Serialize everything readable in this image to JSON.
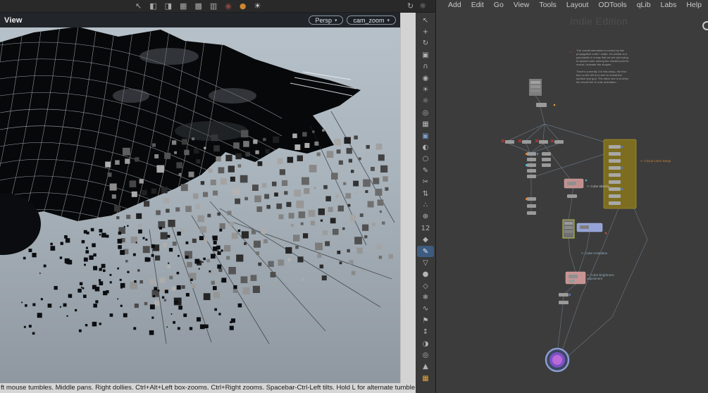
{
  "top_toolbar": {
    "icons": [
      {
        "name": "select-mode-icon",
        "glyph": "↖"
      },
      {
        "name": "viewport-split-icon",
        "glyph": "◧"
      },
      {
        "name": "pane-layout-icon",
        "glyph": "◨"
      },
      {
        "name": "grid-snap-icon",
        "glyph": "▦"
      },
      {
        "name": "multi-pane-icon",
        "glyph": "▩"
      },
      {
        "name": "tab-stack-icon",
        "glyph": "▥"
      },
      {
        "name": "record-icon",
        "glyph": "◉",
        "color": "#8a4545"
      },
      {
        "name": "status-dot-icon",
        "glyph": "●",
        "color": "#d0862f"
      },
      {
        "name": "render-settings-icon",
        "glyph": "☀",
        "color": "#dcdcdc"
      }
    ],
    "right_icons": [
      {
        "name": "sync-icon",
        "glyph": "↻"
      },
      {
        "name": "gear-icon",
        "glyph": "☼"
      }
    ]
  },
  "viewport": {
    "title": "View",
    "persp_label": "Persp",
    "cam_label": "cam_zoom",
    "dropdown_arrow": "▾",
    "help_text": "ft mouse tumbles. Middle pans. Right dollies. Ctrl+Alt+Left box-zooms. Ctrl+Right zooms. Spacebar-Ctrl-Left tilts. Hold L for alternate tumble, dolly, and zoom. M or"
  },
  "side_toolbar": {
    "icons": [
      {
        "name": "select-arrow-icon",
        "glyph": "↖"
      },
      {
        "name": "move-tool-icon",
        "glyph": "+"
      },
      {
        "name": "rotate-tool-icon",
        "glyph": "↻"
      },
      {
        "name": "scale-tool-icon",
        "glyph": "▣"
      },
      {
        "name": "snap-magnet-icon",
        "glyph": "∩"
      },
      {
        "name": "lock-icon",
        "glyph": "◉"
      },
      {
        "name": "light-icon",
        "glyph": "☀"
      },
      {
        "name": "lamp-icon",
        "glyph": "☼"
      },
      {
        "name": "camera-icon",
        "glyph": "◎"
      },
      {
        "name": "grid-icon",
        "glyph": "▦"
      },
      {
        "name": "image-plane-icon",
        "glyph": "▣",
        "color": "#7fa0c8"
      },
      {
        "name": "shading-icon",
        "glyph": "◐"
      },
      {
        "name": "wireframe-icon",
        "glyph": "○"
      },
      {
        "name": "pencil-icon",
        "glyph": "✎"
      },
      {
        "name": "scissors-icon",
        "glyph": "✂"
      },
      {
        "name": "sort-icon",
        "glyph": "⇅"
      },
      {
        "name": "points-icon",
        "glyph": "∴"
      },
      {
        "name": "axis-icon",
        "glyph": "⊕"
      },
      {
        "name": "point-count-icon",
        "glyph": "12"
      },
      {
        "name": "diamond-icon",
        "glyph": "◆"
      },
      {
        "name": "paint-selected-icon",
        "glyph": "✎",
        "bg": "#3d5c80",
        "color": "#e0e8f0"
      },
      {
        "name": "cone-icon",
        "glyph": "▽"
      },
      {
        "name": "sphere-icon",
        "glyph": "●"
      },
      {
        "name": "prism-icon",
        "glyph": "◇"
      },
      {
        "name": "snowflake-icon",
        "glyph": "❄"
      },
      {
        "name": "wave-icon",
        "glyph": "∿"
      },
      {
        "name": "flag-icon",
        "glyph": "⚑"
      },
      {
        "name": "height-icon",
        "glyph": "↕"
      },
      {
        "name": "half-shade-icon",
        "glyph": "◑"
      },
      {
        "name": "target-icon",
        "glyph": "◎"
      },
      {
        "name": "up-icon",
        "glyph": "▲"
      },
      {
        "name": "color-palette-icon",
        "glyph": "▦",
        "color": "#e0a23a"
      }
    ]
  },
  "network_editor": {
    "menu": [
      {
        "name": "menu-add",
        "label": "Add"
      },
      {
        "name": "menu-edit",
        "label": "Edit"
      },
      {
        "name": "menu-go",
        "label": "Go"
      },
      {
        "name": "menu-view",
        "label": "View"
      },
      {
        "name": "menu-tools",
        "label": "Tools"
      },
      {
        "name": "menu-layout",
        "label": "Layout"
      },
      {
        "name": "menu-odtools",
        "label": "ODTools"
      },
      {
        "name": "menu-qlib",
        "label": "qLib"
      },
      {
        "name": "menu-labs",
        "label": "Labs"
      },
      {
        "name": "menu-help",
        "label": "Help"
      }
    ],
    "watermark": "Indie Edition",
    "note_arrow": "<--",
    "note1": "The overall animation is control by this propagation node I made. It's similar to a pyroclastic in a way that we are just trying to spread color among the closest point to reveal / animate the shapes.",
    "note2": "There's currently 3 in this setup, the first two on the left is to size to reveal the surface and grid. The other one is to drive the circuit line & cube animation.",
    "labels": {
      "circuit": "<- Circuit Lines Setup",
      "cube_identity": "<- Cube Identity",
      "cube_animation": "<- Cube Animation",
      "cube_brightness": "<- Cube Brightness adjustment"
    },
    "colors": {
      "group_box": "#7c6d20",
      "pink_node": "#c28f8f",
      "blue_node": "#94a2d6",
      "selection_outline": "#ccd24e",
      "output_ring": "#8a9bd0",
      "output_core": "#bb6ad8",
      "error_badge": "#d23434"
    }
  }
}
